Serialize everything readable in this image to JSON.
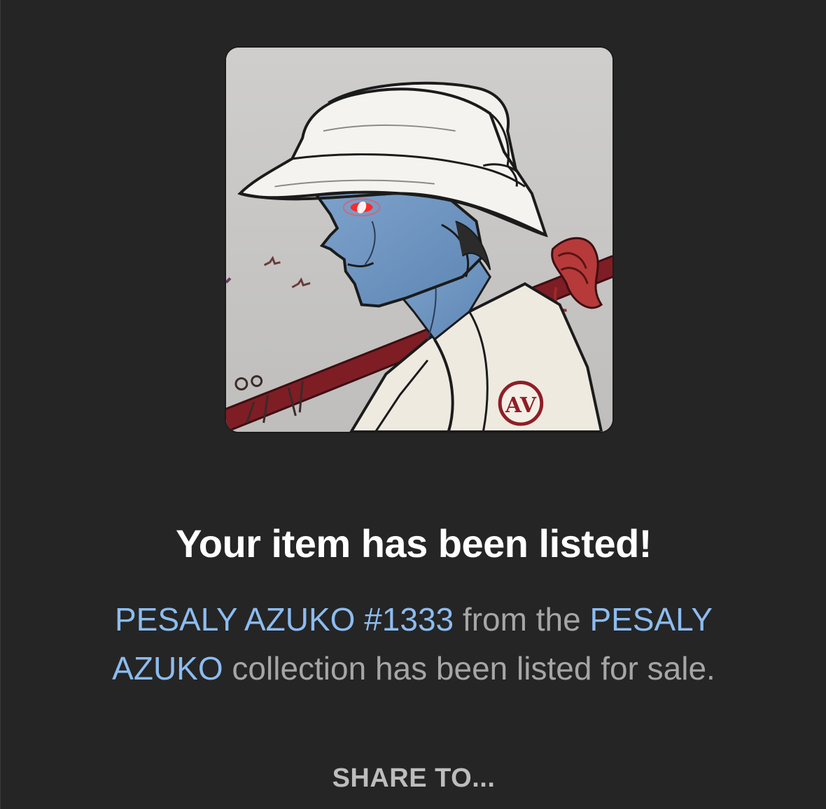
{
  "nft_image": {
    "icon": "samurai-artwork",
    "emblem_text": "AV"
  },
  "dialog": {
    "title": "Your item has been listed!",
    "item_name": "PESALY AZUKO #1333",
    "middle_text": " from the ",
    "collection_name": "PESALY AZUKO",
    "end_text": " collection has been listed for sale.",
    "share_label": "SHARE TO..."
  },
  "colors": {
    "background": "#252525",
    "link": "#8cbcf0",
    "body_text": "#a6a6a6",
    "title_text": "#ffffff"
  }
}
